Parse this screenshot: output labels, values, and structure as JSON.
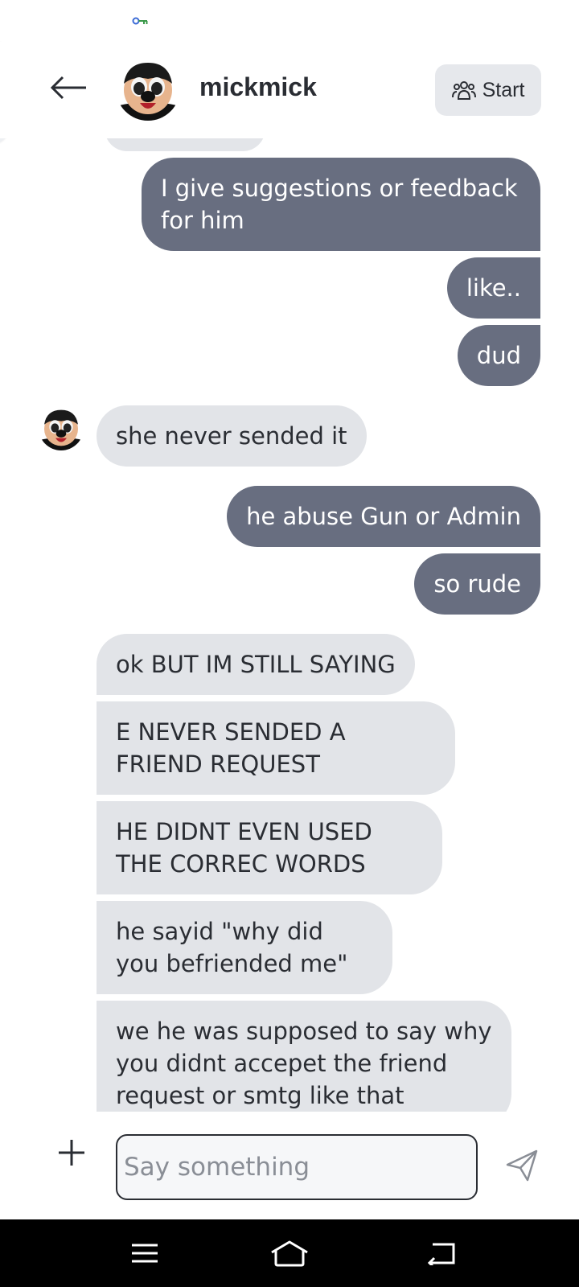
{
  "header": {
    "username": "mickmick",
    "start_label": "Start"
  },
  "messages": [
    {
      "dir": "out",
      "text": "I give suggestions or feedback for him"
    },
    {
      "dir": "out",
      "text": "like.."
    },
    {
      "dir": "out",
      "text": "dud"
    },
    {
      "dir": "in",
      "text": "she never sended it"
    },
    {
      "dir": "out",
      "text": "he abuse Gun or Admin"
    },
    {
      "dir": "out",
      "text": "so rude"
    },
    {
      "dir": "in",
      "text": "ok BUT IM STILL SAYING"
    },
    {
      "dir": "in",
      "text": "E NEVER SENDED A FRIEND REQUEST"
    },
    {
      "dir": "in",
      "text": "HE DIDNT EVEN USED THE CORREC WORDS"
    },
    {
      "dir": "in",
      "text": "he sayid \"why did you befriended me\""
    },
    {
      "dir": "in",
      "text": "we he was supposed to say why you didnt accepet the friend request or smtg like that"
    }
  ],
  "composer": {
    "placeholder": "Say something"
  },
  "colors": {
    "outgoing_bubble": "#686e80",
    "incoming_bubble": "#e2e4e8",
    "start_button": "#e6e8ec"
  }
}
